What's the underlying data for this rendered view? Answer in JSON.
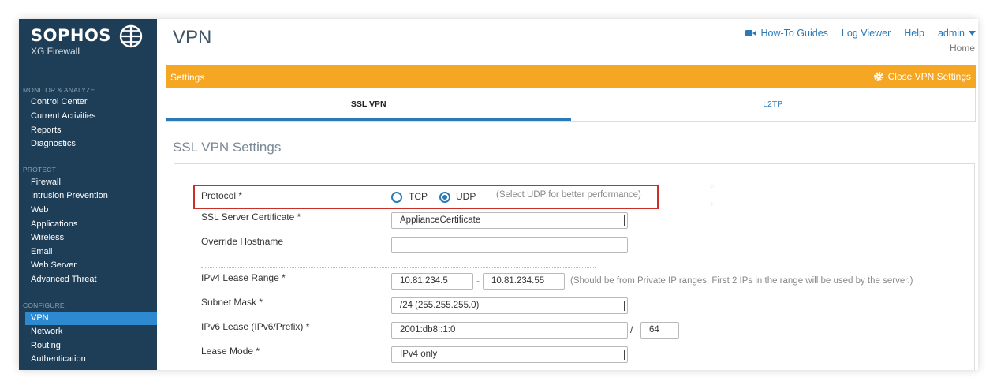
{
  "sidebar": {
    "brand": "SOPHOS",
    "product": "XG Firewall",
    "sections": [
      {
        "label": "MONITOR & ANALYZE",
        "items": [
          "Control Center",
          "Current Activities",
          "Reports",
          "Diagnostics"
        ]
      },
      {
        "label": "PROTECT",
        "items": [
          "Firewall",
          "Intrusion Prevention",
          "Web",
          "Applications",
          "Wireless",
          "Email",
          "Web Server",
          "Advanced Threat"
        ]
      },
      {
        "label": "CONFIGURE",
        "items": [
          "VPN",
          "Network",
          "Routing",
          "Authentication"
        ]
      }
    ],
    "active_item": "VPN"
  },
  "header": {
    "title": "VPN",
    "nav": {
      "howto": "How-To Guides",
      "logviewer": "Log Viewer",
      "help": "Help",
      "admin": "admin"
    },
    "breadcrumb": "Home"
  },
  "settings_bar": {
    "label": "Settings",
    "close_label": "Close VPN Settings"
  },
  "tabs": [
    {
      "label": "SSL VPN",
      "active": true
    },
    {
      "label": "L2TP",
      "active": false
    }
  ],
  "section_title": "SSL VPN Settings",
  "form": {
    "protocol": {
      "label": "Protocol *",
      "options": [
        "TCP",
        "UDP"
      ],
      "selected": "UDP",
      "hint": "(Select UDP for better performance)"
    },
    "certificate": {
      "label": "SSL Server Certificate *",
      "value": "ApplianceCertificate"
    },
    "hostname": {
      "label": "Override Hostname",
      "value": ""
    },
    "ipv4_range": {
      "label": "IPv4 Lease Range *",
      "start": "10.81.234.5",
      "separator": "-",
      "end": "10.81.234.55",
      "hint": "(Should be from Private IP ranges. First 2 IPs in the range will be used by the server.)"
    },
    "subnet": {
      "label": "Subnet Mask *",
      "value": "/24 (255.255.255.0)"
    },
    "ipv6": {
      "label": "IPv6 Lease (IPv6/Prefix) *",
      "value": "2001:db8::1:0",
      "separator": "/",
      "prefix": "64"
    },
    "lease_mode": {
      "label": "Lease Mode *",
      "value": "IPv4 only"
    }
  },
  "colors": {
    "sidebar": "#1e3e57",
    "accent": "#2d8ad0",
    "settings_bar": "#f5a623",
    "highlight": "#c9302c"
  }
}
